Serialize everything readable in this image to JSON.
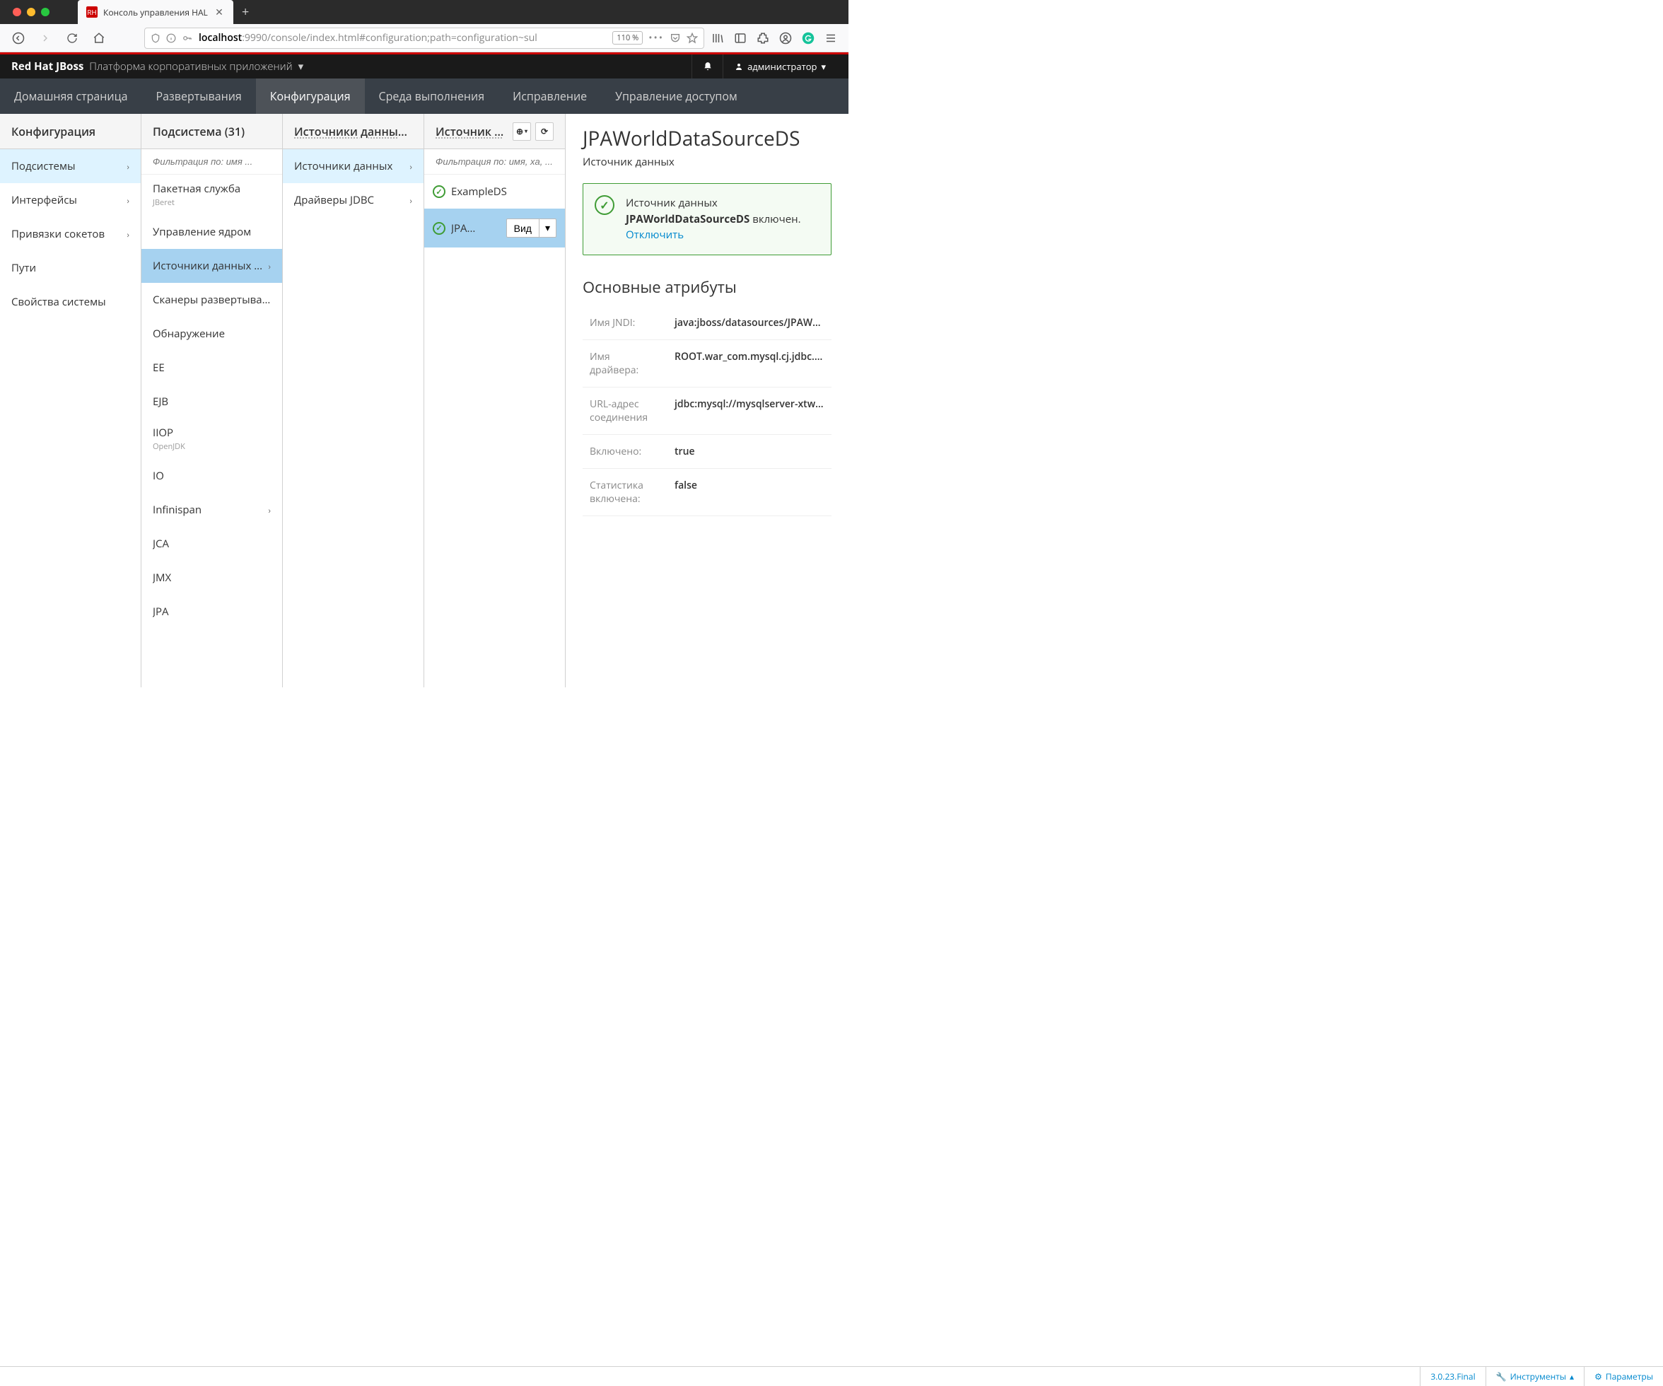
{
  "browser": {
    "tab_title": "Консоль управления HAL",
    "url_prefix": "localhost",
    "url_suffix": ":9990/console/index.html#configuration;path=configuration~sul",
    "zoom": "110 %"
  },
  "header": {
    "brand_bold1": "Red Hat ",
    "brand_bold2": "JBoss",
    "brand_light": "Платформа корпоративных приложений",
    "user": "администратор"
  },
  "nav": {
    "home": "Домашняя страница",
    "deployments": "Развертывания",
    "configuration": "Конфигурация",
    "runtime": "Среда выполнения",
    "patching": "Исправление",
    "access": "Управление доступом"
  },
  "col1": {
    "header": "Конфигурация",
    "items": {
      "subsystems": "Подсистемы",
      "interfaces": "Интерфейсы",
      "sockets": "Привязки сокетов",
      "paths": "Пути",
      "sysprops": "Свойства системы"
    }
  },
  "col2": {
    "header": "Подсистема (31)",
    "filter_placeholder": "Фильтрация по: имя ...",
    "items": {
      "batch": "Пакетная служба",
      "batch_sub": "JBeret",
      "core": "Управление ядром",
      "datasources": "Источники данных ...",
      "deployscanners": "Сканеры развертывания",
      "discovery": "Обнаружение",
      "ee": "EE",
      "ejb": "EJB",
      "iiop": "IIOP",
      "iiop_sub": "OpenJDK",
      "io": "IO",
      "infinispan": "Infinispan",
      "jca": "JCA",
      "jmx": "JMX",
      "jpa": "JPA"
    }
  },
  "col3": {
    "header": "Источники данных ...",
    "items": {
      "datasources": "Источники данных",
      "drivers": "Драйверы JDBC"
    }
  },
  "col4": {
    "header": "Источник ...",
    "filter_placeholder": "Фильтрация по: имя, xa, ...",
    "items": {
      "example": "ExampleDS",
      "jpa": "JPA...",
      "view_btn": "Вид"
    }
  },
  "detail": {
    "title": "JPAWorldDataSourceDS",
    "subtitle": "Источник данных",
    "alert_prefix": "Источник данных ",
    "alert_dsname": "JPAWorldDataSourceDS",
    "alert_enabled": " включен. ",
    "alert_disable": "Отключить",
    "section_title": "Основные атрибуты",
    "attrs": {
      "jndi_k": "Имя JNDI:",
      "jndi_v": "java:jboss/datasources/JPAWorl...",
      "driver_k": "Имя драйвера:",
      "driver_v": "ROOT.war_com.mysql.cj.jdbc.Dri...",
      "url_k": "URL-адрес соединения",
      "url_v": "jdbc:mysql://mysqlserver-xtwsy...",
      "enabled_k": "Включено:",
      "enabled_v": "true",
      "stats_k": "Статистика включена:",
      "stats_v": "false"
    }
  },
  "footer": {
    "version": "3.0.23.Final",
    "tools": "Инструменты",
    "settings": "Параметры"
  }
}
